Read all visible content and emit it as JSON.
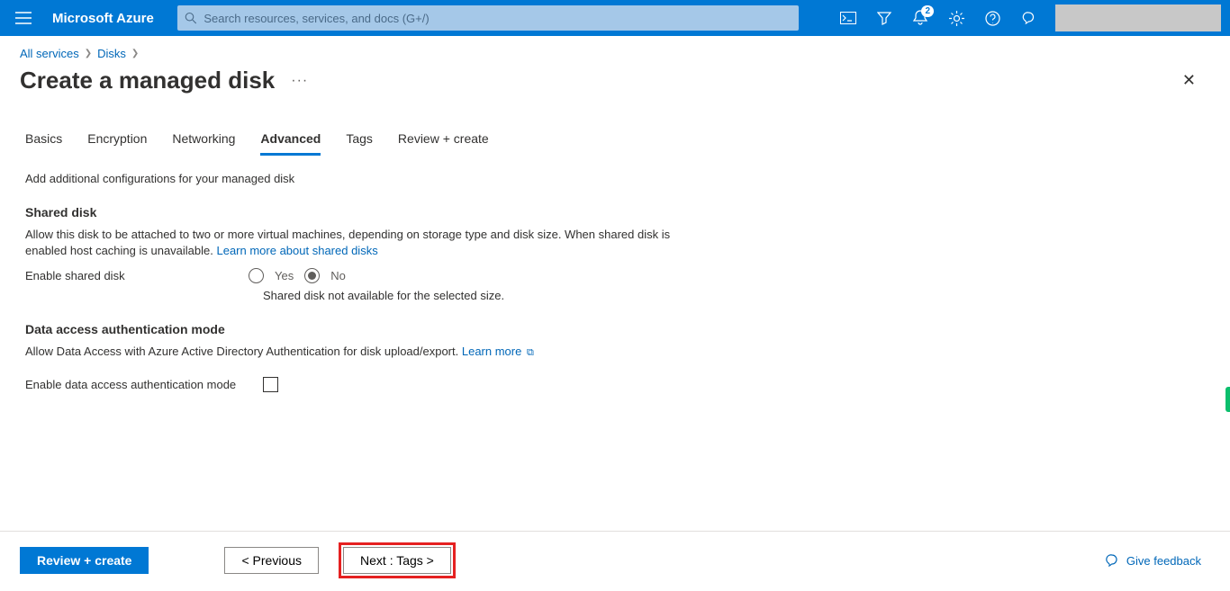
{
  "header": {
    "brand": "Microsoft Azure",
    "search_placeholder": "Search resources, services, and docs (G+/)",
    "notification_count": "2"
  },
  "breadcrumb": {
    "items": [
      "All services",
      "Disks"
    ]
  },
  "page": {
    "title": "Create a managed disk"
  },
  "tabs": {
    "items": [
      {
        "label": "Basics"
      },
      {
        "label": "Encryption"
      },
      {
        "label": "Networking"
      },
      {
        "label": "Advanced"
      },
      {
        "label": "Tags"
      },
      {
        "label": "Review + create"
      }
    ],
    "active_index": 3
  },
  "content": {
    "intro": "Add additional configurations for your managed disk",
    "shared_disk": {
      "heading": "Shared disk",
      "text": "Allow this disk to be attached to two or more virtual machines, depending on storage type and disk size. When shared disk is enabled host caching is unavailable. ",
      "learn_more": "Learn more about shared disks",
      "field_label": "Enable shared disk",
      "option_yes": "Yes",
      "option_no": "No",
      "warning": "Shared disk not available for the selected size."
    },
    "data_access": {
      "heading": "Data access authentication mode",
      "text": "Allow Data Access with Azure Active Directory Authentication for disk upload/export. ",
      "learn_more": "Learn more",
      "field_label": "Enable data access authentication mode"
    }
  },
  "footer": {
    "review": "Review + create",
    "previous": "< Previous",
    "next": "Next : Tags >",
    "feedback": "Give feedback"
  }
}
